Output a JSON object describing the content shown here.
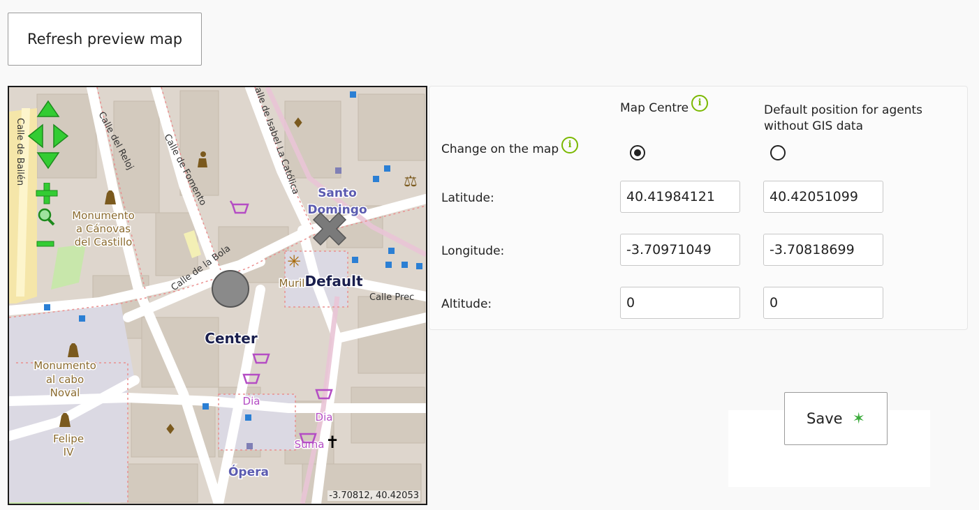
{
  "toolbar": {
    "refresh_label": "Refresh preview map"
  },
  "map": {
    "streets": {
      "calle_de_bailen": "Calle de Bailén",
      "calle_del_reloj": "Calle del Reloj",
      "calle_de_fomento": "Calle de Fomento",
      "calle_isabel": "alle de Isabel La Católica",
      "calle_de_la_bola": "Calle de la Bola",
      "calle_prec": "Calle Prec"
    },
    "places": {
      "monumento_canovas": [
        "Monumento",
        "a Cánovas",
        "del Castillo"
      ],
      "monumento_noval": [
        "Monumento",
        "al cabo",
        "Noval"
      ],
      "felipe": [
        "Felipe",
        "IV"
      ],
      "santo_domingo": [
        "Santo",
        "Domingo"
      ],
      "opera": "Ópera",
      "muril": "Muril",
      "dia1": "Dia",
      "dia2": "Dia",
      "suma": "Suma"
    },
    "markers": {
      "default_label": "Default",
      "center_label": "Center"
    },
    "coord_readout": "-3.70812, 40.42053",
    "colors": {
      "land": "#ded6cd",
      "road": "#ffffff",
      "park": "#c8e7ab",
      "building": "#d5ccc2",
      "footway": "#ea8f8f",
      "pedestrian": "#e9c4d6",
      "transit": "#2b7fd4",
      "shop": "#b44dc4",
      "poi": "#7b5a1e"
    },
    "icons": [
      "pan-up-icon",
      "pan-left-icon",
      "pan-right-icon",
      "pan-down-icon",
      "zoom-in-icon",
      "zoom-world-icon",
      "zoom-out-icon"
    ]
  },
  "panel": {
    "col_map_centre": "Map Centre",
    "col_default_position": "Default position for agents without GIS data",
    "row_change_on_map": "Change on the map",
    "row_latitude": "Latitude:",
    "row_longitude": "Longitude:",
    "row_altitude": "Altitude:",
    "center": {
      "latitude": "40.41984121",
      "longitude": "-3.70971049",
      "altitude": "0",
      "selected": true
    },
    "default": {
      "latitude": "40.42051099",
      "longitude": "-3.70818699",
      "altitude": "0",
      "selected": false
    },
    "info_glyph": "i",
    "accent": "#7ab800"
  },
  "footer": {
    "save_label": "Save",
    "save_icon": "wand-icon"
  }
}
